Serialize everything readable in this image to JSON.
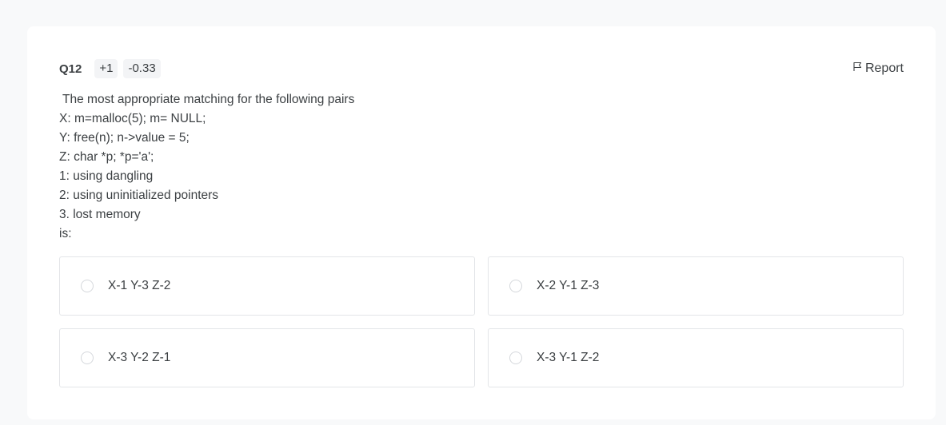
{
  "question": {
    "number": "Q12",
    "positive_marks": "+1",
    "negative_marks": "-0.33",
    "report_label": "Report",
    "lines": [
      " The most appropriate matching for the following pairs",
      "X: m=malloc(5); m= NULL;",
      "Y: free(n); n->value = 5;",
      "Z: char *p; *p='a';",
      "1: using dangling",
      "2: using uninitialized pointers",
      "3. lost memory",
      "is:"
    ]
  },
  "options": [
    {
      "label": "X-1 Y-3 Z-2"
    },
    {
      "label": "X-2 Y-1 Z-3"
    },
    {
      "label": "X-3 Y-2 Z-1"
    },
    {
      "label": "X-3 Y-1 Z-2"
    }
  ],
  "icons": {
    "report": "flag-icon",
    "option": "radio-icon"
  },
  "colors": {
    "background": "#f8f9fa",
    "card": "#ffffff",
    "text": "#3c4043",
    "badge": "#f3f4f6",
    "border": "#e3e5e8"
  }
}
